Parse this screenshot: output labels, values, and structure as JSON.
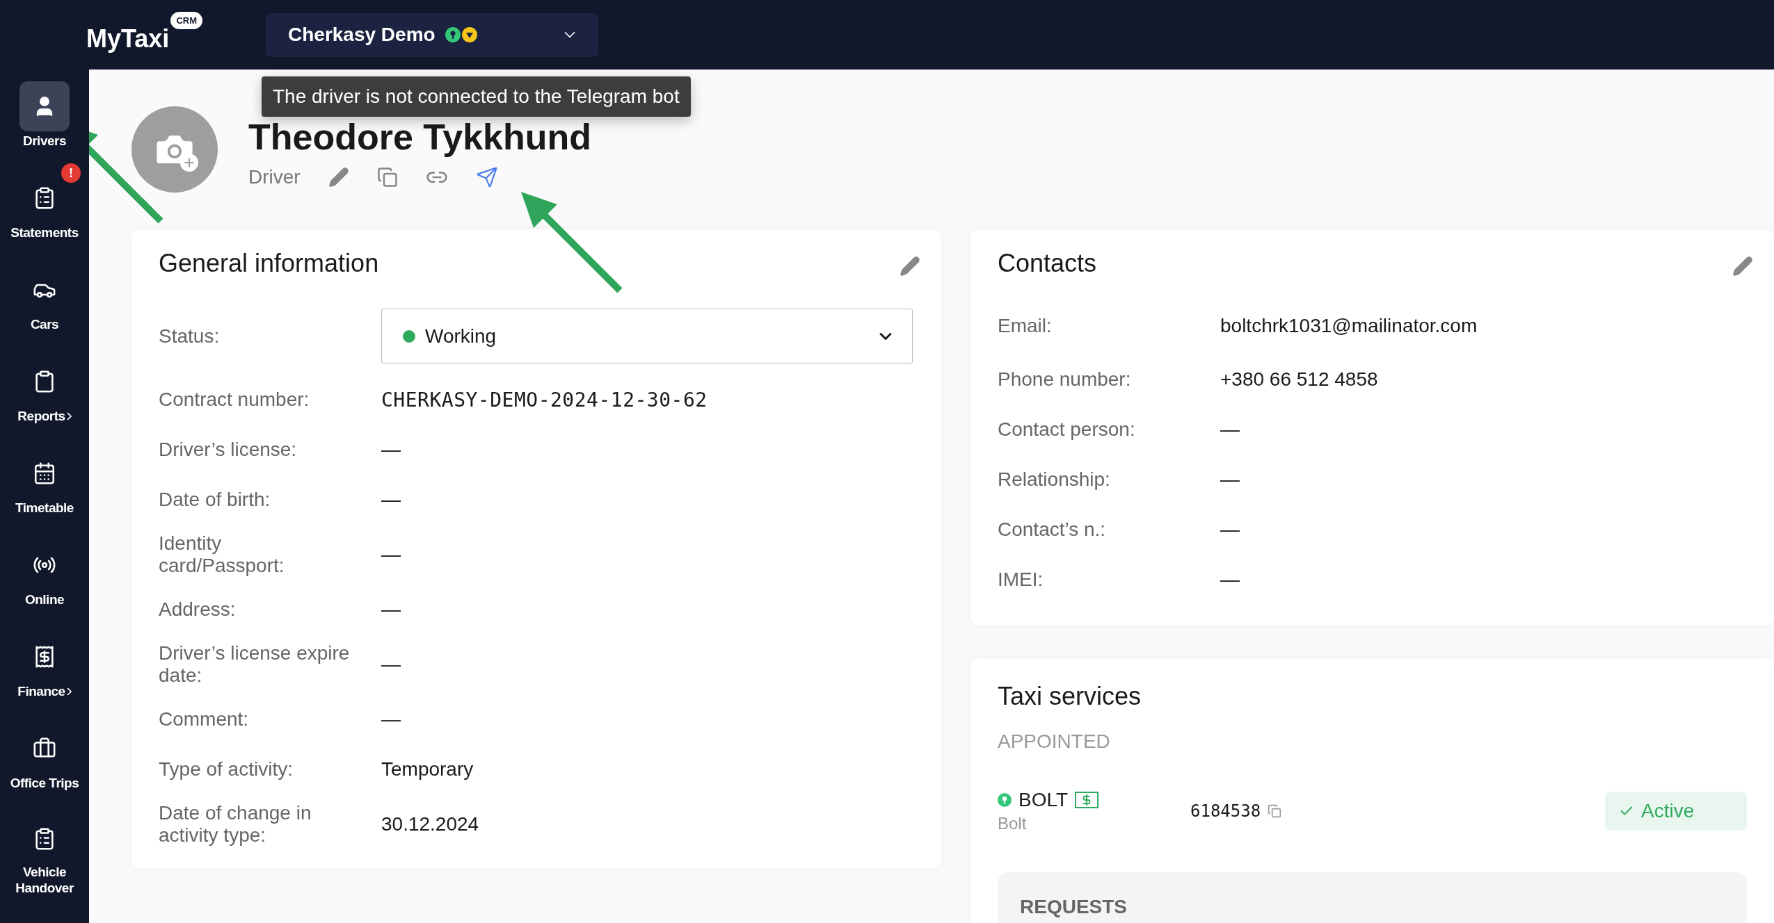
{
  "brand": {
    "name": "MyTaxi",
    "badge": "CRM"
  },
  "company": {
    "name": "Cherkasy Demo"
  },
  "sidebar": {
    "items": [
      {
        "label": "Drivers",
        "selected": true,
        "submenu": false
      },
      {
        "label": "Statements",
        "selected": false,
        "submenu": false,
        "alert": "!"
      },
      {
        "label": "Cars",
        "selected": false,
        "submenu": false
      },
      {
        "label": "Reports",
        "selected": false,
        "submenu": true
      },
      {
        "label": "Timetable",
        "selected": false,
        "submenu": false
      },
      {
        "label": "Online",
        "selected": false,
        "submenu": false
      },
      {
        "label": "Finance",
        "selected": false,
        "submenu": true
      },
      {
        "label": "Office Trips",
        "selected": false,
        "submenu": false
      },
      {
        "label": "Vehicle Handover",
        "selected": false,
        "submenu": false
      }
    ]
  },
  "profile": {
    "name": "Theodore Tykkhund",
    "role": "Driver",
    "tooltip": "The driver is not connected to the Telegram bot"
  },
  "general": {
    "title": "General information",
    "rows": [
      {
        "kind": "select",
        "label": "Status:",
        "value": "Working",
        "color": "#2eaa5c"
      },
      {
        "kind": "mono",
        "label": "Contract number:",
        "value": "CHERKASY-DEMO-2024-12-30-62"
      },
      {
        "kind": "text",
        "label": "Driver’s license:",
        "value": "—"
      },
      {
        "kind": "text",
        "label": "Date of birth:",
        "value": "—"
      },
      {
        "kind": "text",
        "label": "Identity card/Passport:",
        "value": "—"
      },
      {
        "kind": "text",
        "label": "Address:",
        "value": "—"
      },
      {
        "kind": "text",
        "label": "Driver’s license expire date:",
        "value": "—"
      },
      {
        "kind": "text",
        "label": "Comment:",
        "value": "—"
      },
      {
        "kind": "text",
        "label": "Type of activity:",
        "value": "Temporary"
      },
      {
        "kind": "text",
        "label": "Date of change in activity type:",
        "value": "30.12.2024"
      }
    ]
  },
  "contacts": {
    "title": "Contacts",
    "rows": [
      {
        "label": "Email:",
        "value": "boltchrk1031@mailinator.com"
      },
      {
        "label": "Phone number:",
        "value": "+380 66 512 4858"
      },
      {
        "label": "Contact person:",
        "value": "—"
      },
      {
        "label": "Relationship:",
        "value": "—"
      },
      {
        "label": "Contact’s n.:",
        "value": "—"
      },
      {
        "label": "IMEI:",
        "value": "—"
      }
    ]
  },
  "taxi_services": {
    "title": "Taxi services",
    "section": "APPOINTED",
    "services": [
      {
        "name": "BOLT",
        "subtitle": "Bolt",
        "id": "6184538",
        "status": "Active",
        "active": true
      }
    ],
    "requests": {
      "title": "REQUESTS"
    }
  }
}
